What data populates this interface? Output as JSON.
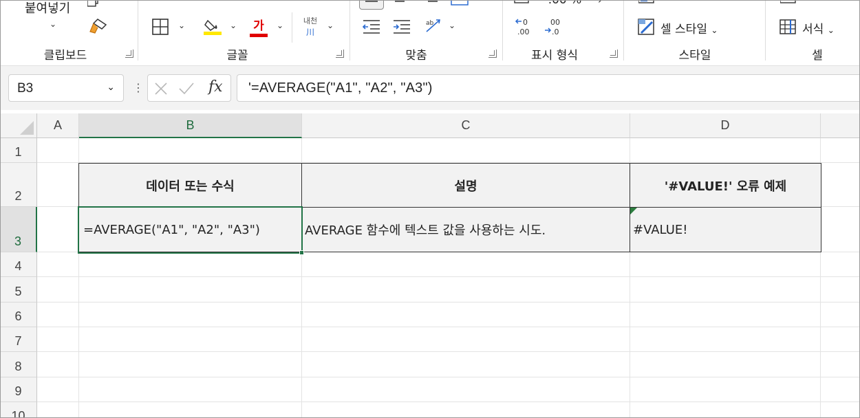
{
  "ribbon": {
    "paste_label": "붙여넣기",
    "groups": [
      {
        "label": "클립보드"
      },
      {
        "label": "글꼴"
      },
      {
        "label": "맞춤"
      },
      {
        "label": "표시 형식"
      },
      {
        "label": "스타일"
      },
      {
        "label": "셀"
      }
    ],
    "cell_style_label": "셀 스타일",
    "format_label": "서식",
    "font_color_glyph": "가",
    "phonetic_glyph": "내천",
    "fill_color": "#ffe800",
    "font_color": "#e00000"
  },
  "formula_bar": {
    "name_box": "B3",
    "fx_label": "fx",
    "formula": "'=AVERAGE(\"A1\", \"A2\", \"A3\")"
  },
  "grid": {
    "columns": [
      "A",
      "B",
      "C",
      "D"
    ],
    "rows": [
      "1",
      "2",
      "3",
      "4",
      "5",
      "6",
      "7",
      "8",
      "9",
      "10"
    ],
    "selected_cell": "B3",
    "table": {
      "headers": [
        "데이터 또는 수식",
        "설명",
        "'#VALUE!' 오류 예제"
      ],
      "row": [
        "=AVERAGE(\"A1\", \"A2\", \"A3\")",
        "AVERAGE 함수에 텍스트 값을 사용하는 시도.",
        "#VALUE!"
      ]
    }
  },
  "colors": {
    "accent": "#217346",
    "header_fill": "#f2f2f2"
  }
}
